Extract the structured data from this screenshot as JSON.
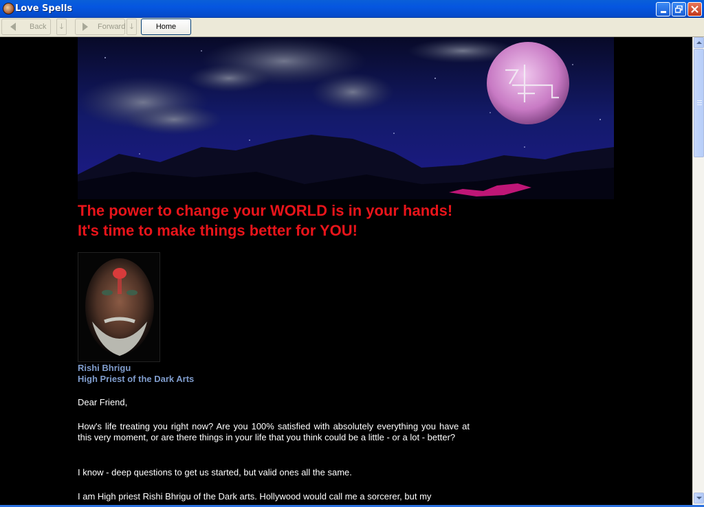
{
  "window": {
    "title": "Love Spells"
  },
  "toolbar": {
    "back_label": "Back",
    "forward_label": "Forward",
    "home_label": "Home"
  },
  "page": {
    "headline": "The power to change your WORLD is in your hands! It's time to make things better for YOU!",
    "author_name": "Rishi Bhrigu",
    "author_title": "High Priest of the Dark Arts",
    "paragraphs": [
      "Dear Friend,",
      "How's life treating you right now? Are you 100% satisfied with absolutely everything you have at this very moment, or are there things in your life that you think could be a little - or a lot - better?",
      "I know - deep questions to get us started, but valid ones all the same.",
      "I am High priest Rishi Bhrigu of the Dark arts. Hollywood would call me a sorcerer, but my"
    ]
  },
  "colors": {
    "headline": "#e8141a",
    "author": "#7f9ccc",
    "body_text": "#ffffff",
    "background": "#000000"
  },
  "icons": {
    "app": "app-icon",
    "minimize": "minimize-icon",
    "restore": "restore-icon",
    "close": "close-icon",
    "back": "back-arrow-icon",
    "forward": "forward-arrow-icon"
  }
}
